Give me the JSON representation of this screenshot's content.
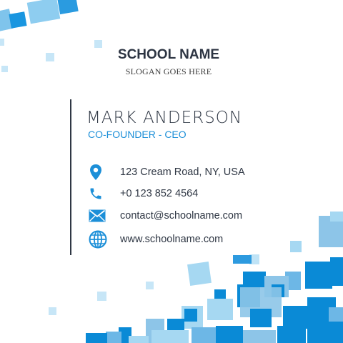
{
  "brand": {
    "school_name": "SCHOOL NAME",
    "slogan": "SLOGAN GOES HERE"
  },
  "person": {
    "name": "MARK ANDERSON",
    "title": "CO-FOUNDER - CEO"
  },
  "contacts": [
    {
      "icon": "location-pin-icon",
      "text": "123 Cream Road, NY, USA"
    },
    {
      "icon": "phone-icon",
      "text": "+0 123 852 4564"
    },
    {
      "icon": "envelope-icon",
      "text": "contact@schoolname.com"
    },
    {
      "icon": "globe-icon",
      "text": "www.schoolname.com"
    }
  ],
  "colors": {
    "accent": "#1c8fd8",
    "text_dark": "#2f3744",
    "deco_blue": "#0a8ad6",
    "deco_light": "#a6d8f2"
  }
}
